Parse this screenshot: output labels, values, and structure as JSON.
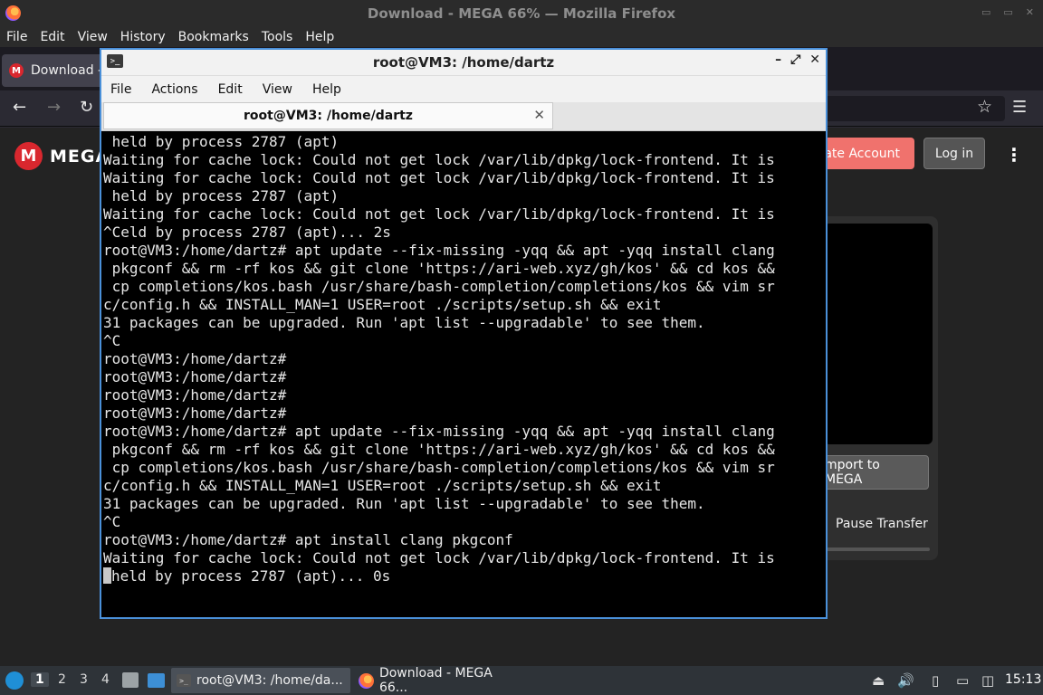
{
  "firefox": {
    "window_title": "Download - MEGA 66% — Mozilla Firefox",
    "menu": [
      "File",
      "Edit",
      "View",
      "History",
      "Bookmarks",
      "Tools",
      "Help"
    ],
    "tab_label": "Download -",
    "favicon_letter": "M"
  },
  "mega": {
    "logo_text": "MEGA",
    "logo_letter": "M",
    "create_account": "eate Account",
    "log_in": "Log in",
    "import_button": "mport to MEGA",
    "pause_transfer": "Pause Transfer"
  },
  "terminal": {
    "window_title": "root@VM3: /home/dartz",
    "menu": [
      "File",
      "Actions",
      "Edit",
      "View",
      "Help"
    ],
    "tab_title": "root@VM3: /home/dartz",
    "lines": [
      " held by process 2787 (apt)",
      "Waiting for cache lock: Could not get lock /var/lib/dpkg/lock-frontend. It is",
      "Waiting for cache lock: Could not get lock /var/lib/dpkg/lock-frontend. It is",
      " held by process 2787 (apt)",
      "Waiting for cache lock: Could not get lock /var/lib/dpkg/lock-frontend. It is",
      "^Celd by process 2787 (apt)... 2s",
      "root@VM3:/home/dartz# apt update --fix-missing -yqq && apt -yqq install clang",
      " pkgconf && rm -rf kos && git clone 'https://ari-web.xyz/gh/kos' && cd kos &&",
      " cp completions/kos.bash /usr/share/bash-completion/completions/kos && vim sr",
      "c/config.h && INSTALL_MAN=1 USER=root ./scripts/setup.sh && exit",
      "31 packages can be upgraded. Run 'apt list --upgradable' to see them.",
      "^C",
      "root@VM3:/home/dartz#",
      "root@VM3:/home/dartz#",
      "root@VM3:/home/dartz#",
      "root@VM3:/home/dartz#",
      "root@VM3:/home/dartz# apt update --fix-missing -yqq && apt -yqq install clang",
      " pkgconf && rm -rf kos && git clone 'https://ari-web.xyz/gh/kos' && cd kos &&",
      " cp completions/kos.bash /usr/share/bash-completion/completions/kos && vim sr",
      "c/config.h && INSTALL_MAN=1 USER=root ./scripts/setup.sh && exit",
      "31 packages can be upgraded. Run 'apt list --upgradable' to see them.",
      "^C",
      "root@VM3:/home/dartz# apt install clang pkgconf",
      "Waiting for cache lock: Could not get lock /var/lib/dpkg/lock-frontend. It is"
    ],
    "last_line": "held by process 2787 (apt)... 0s"
  },
  "taskbar": {
    "workspaces": [
      "1",
      "2",
      "3",
      "4"
    ],
    "terminal_task": "root@VM3: /home/da...",
    "firefox_task": "Download - MEGA 66...",
    "clock": "15:13"
  }
}
